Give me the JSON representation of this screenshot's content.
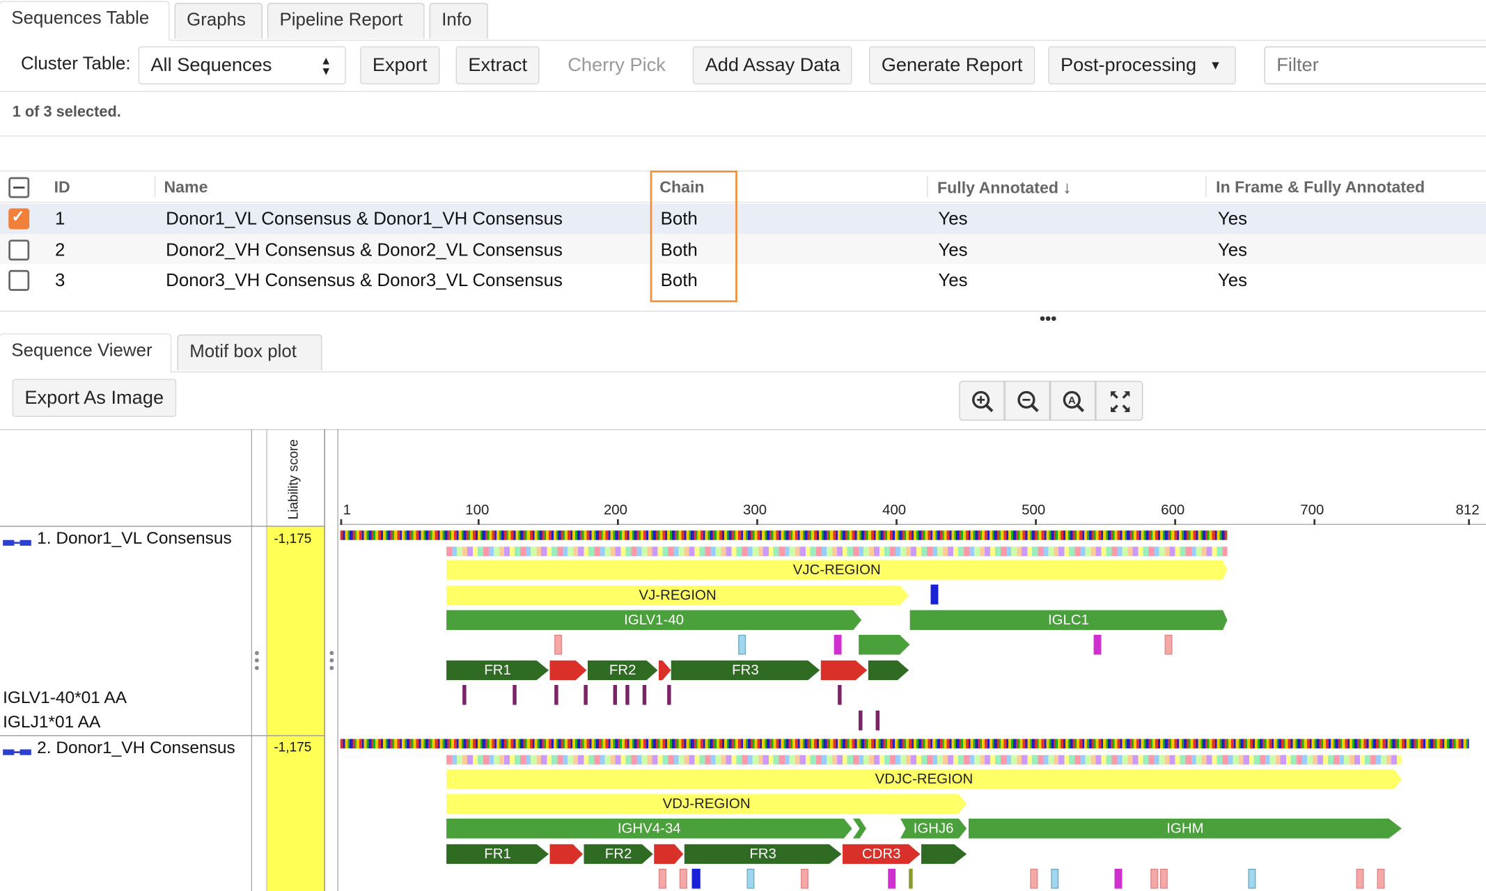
{
  "tabs_top": [
    {
      "label": "Sequences Table",
      "active": true
    },
    {
      "label": "Graphs",
      "active": false
    },
    {
      "label": "Pipeline Report",
      "active": false
    },
    {
      "label": "Info",
      "active": false
    }
  ],
  "toolbar": {
    "cluster_label": "Cluster Table:",
    "cluster_value": "All Sequences",
    "export": "Export",
    "extract": "Extract",
    "cherry_pick": "Cherry Pick",
    "add_assay": "Add Assay Data",
    "generate_report": "Generate Report",
    "post_processing": "Post-processing",
    "filter_placeholder": "Filter"
  },
  "selection_status": "1 of 3 selected.",
  "table": {
    "columns": [
      "ID",
      "Name",
      "Chain",
      "Fully Annotated",
      "In Frame & Fully Annotated"
    ],
    "rows": [
      {
        "id": "1",
        "name": "Donor1_VL Consensus & Donor1_VH Consensus",
        "chain": "Both",
        "fully": "Yes",
        "inframe": "Yes",
        "checked": true
      },
      {
        "id": "2",
        "name": "Donor2_VH Consensus & Donor2_VL Consensus",
        "chain": "Both",
        "fully": "Yes",
        "inframe": "Yes",
        "checked": false
      },
      {
        "id": "3",
        "name": "Donor3_VH Consensus & Donor3_VL Consensus",
        "chain": "Both",
        "fully": "Yes",
        "inframe": "Yes",
        "checked": false
      }
    ],
    "splitter": "•••"
  },
  "tabs_bottom": [
    {
      "label": "Sequence Viewer",
      "active": true
    },
    {
      "label": "Motif box plot",
      "active": false
    }
  ],
  "viewer": {
    "export_image": "Export As Image",
    "zoom_icons": [
      "zoom-in-icon",
      "zoom-out-icon",
      "zoom-reset-icon",
      "fit-screen-icon"
    ],
    "liability_header": "Liability score",
    "ruler": [
      "1",
      "100",
      "200",
      "300",
      "400",
      "500",
      "600",
      "700",
      "812"
    ],
    "tracks": {
      "seq1": {
        "name": "1. Donor1_VL Consensus",
        "score": "-1,175"
      },
      "germline_v": "IGLV1-40*01 AA",
      "germline_j": "IGLJ1*01 AA",
      "seq2": {
        "name": "2. Donor1_VH Consensus",
        "score": "-1,175"
      }
    },
    "features": {
      "vjc": "VJC-REGION",
      "vj": "VJ-REGION",
      "iglv": "IGLV1-40",
      "iglc": "IGLC1",
      "fr1": "FR1",
      "fr2": "FR2",
      "fr3": "FR3",
      "vdjc": "VDJC-REGION",
      "vdj": "VDJ-REGION",
      "ighv": "IGHV4-34",
      "ighj": "IGHJ6",
      "ighm": "IGHM",
      "fr1b": "FR1",
      "fr2b": "FR2",
      "fr3b": "FR3",
      "cdr3": "CDR3"
    }
  },
  "colors": {
    "accent_orange": "#f0903a",
    "region_yellow": "#ffff66",
    "gene_green": "#4aa03a",
    "fr_darkgreen": "#2f6b23",
    "cdr_red": "#d9312a",
    "selected_row": "#e8edf6"
  }
}
